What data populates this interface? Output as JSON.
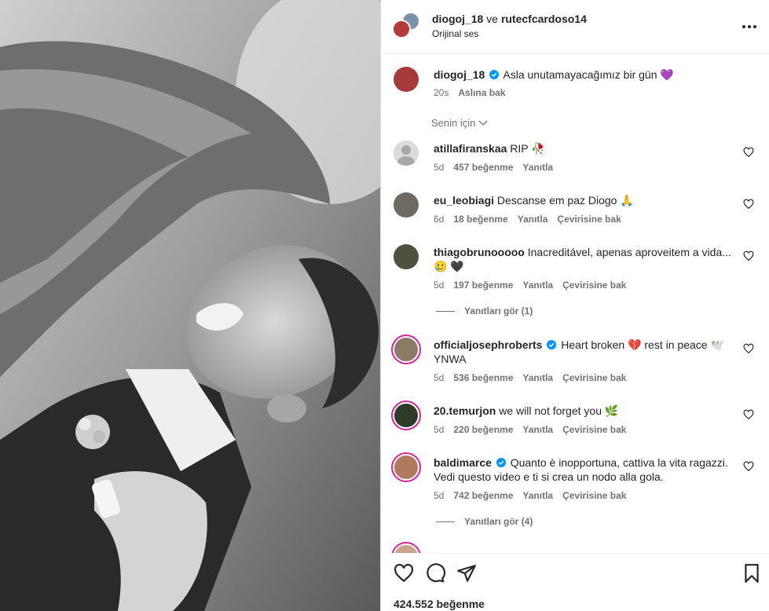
{
  "header": {
    "user1": "diogoj_18",
    "conj": "ve",
    "user2": "rutecfcardoso14",
    "audio": "Orijinal ses"
  },
  "caption": {
    "user": "diogoj_18",
    "text": "Asla unutamayacağımız bir gün 💜",
    "time": "20s",
    "translate": "Aslına bak"
  },
  "sort_label": "Senin için",
  "comments": [
    {
      "user": "atillafiranskaa",
      "text": "RIP 🥀",
      "time": "5d",
      "likes": "457 beğenme",
      "reply": "Yanıtla",
      "translate": ""
    },
    {
      "user": "eu_leobiagi",
      "text": "Descanse em paz Diogo 🙏",
      "time": "6d",
      "likes": "18 beğenme",
      "reply": "Yanıtla",
      "translate": "Çevirisine bak"
    },
    {
      "user": "thiagobrunooooo",
      "text": "Inacreditável, apenas aproveitem a vida...🥲 🖤",
      "time": "5d",
      "likes": "197 beğenme",
      "reply": "Yanıtla",
      "translate": "Çevirisine bak",
      "replies": "Yanıtları gör (1)"
    },
    {
      "user": "officialjosephroberts",
      "text": "Heart broken 💔 rest in peace 🕊️ YNWA",
      "time": "5d",
      "likes": "536 beğenme",
      "reply": "Yanıtla",
      "translate": "Çevirisine bak"
    },
    {
      "user": "20.temurjon",
      "text": "we will not forget you 🌿",
      "time": "5d",
      "likes": "220 beğenme",
      "reply": "Yanıtla",
      "translate": "Çevirisine bak"
    },
    {
      "user": "baldimarce",
      "text": "Quanto è inopportuna, cattiva la vita ragazzi. Vedi questo video e ti si crea un nodo alla gola.",
      "time": "5d",
      "likes": "742 beğenme",
      "reply": "Yanıtla",
      "translate": "Çevirisine bak",
      "replies": "Yanıtları gör (4)"
    }
  ],
  "footer": {
    "likes": "424.552 beğenme"
  },
  "colors": {
    "verified": "#0095f6",
    "meta": "#737373",
    "text": "#262626",
    "ring": "#d6249f"
  },
  "icons": [
    "more-icon",
    "verified-icon",
    "heart-icon",
    "comment-icon",
    "share-icon",
    "save-icon",
    "chevron-down-icon"
  ]
}
